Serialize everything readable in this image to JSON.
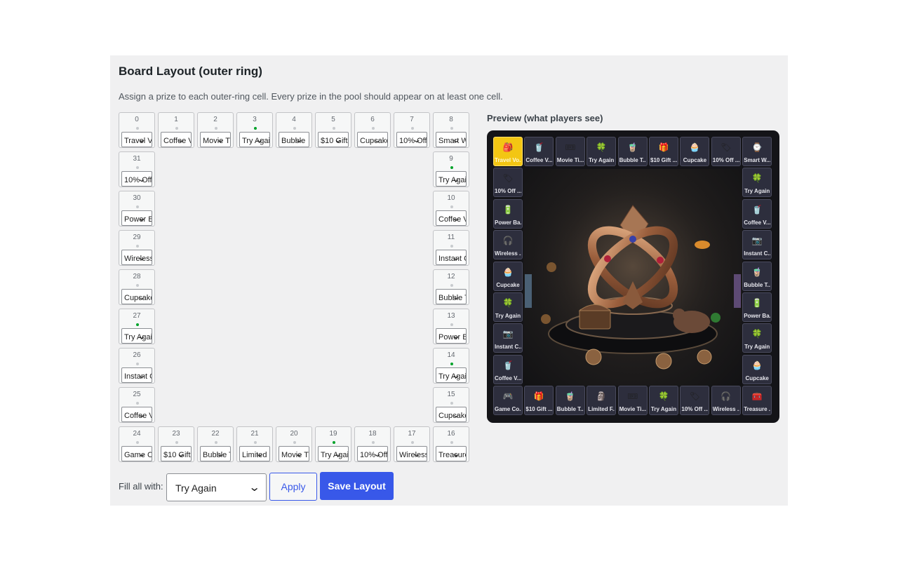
{
  "title": "Board Layout (outer ring)",
  "description": "Assign a prize to each outer-ring cell. Every prize in the pool should appear on at least one cell.",
  "cells": [
    {
      "index": "0",
      "value": "Travel V"
    },
    {
      "index": "1",
      "value": "Coffee V"
    },
    {
      "index": "2",
      "value": "Movie T"
    },
    {
      "index": "3",
      "value": "Try Agai"
    },
    {
      "index": "4",
      "value": "Bubble"
    },
    {
      "index": "5",
      "value": "$10 Gift"
    },
    {
      "index": "6",
      "value": "Cupcake"
    },
    {
      "index": "7",
      "value": "10% Off"
    },
    {
      "index": "8",
      "value": "Smart W"
    },
    {
      "index": "9",
      "value": "Try Agai"
    },
    {
      "index": "10",
      "value": "Coffee V"
    },
    {
      "index": "11",
      "value": "Instant C"
    },
    {
      "index": "12",
      "value": "Bubble T"
    },
    {
      "index": "13",
      "value": "Power B"
    },
    {
      "index": "14",
      "value": "Try Agai"
    },
    {
      "index": "15",
      "value": "Cupcake"
    },
    {
      "index": "16",
      "value": "Treasure"
    },
    {
      "index": "17",
      "value": "Wireless"
    },
    {
      "index": "18",
      "value": "10% Off"
    },
    {
      "index": "19",
      "value": "Try Agai"
    },
    {
      "index": "20",
      "value": "Movie T"
    },
    {
      "index": "21",
      "value": "Limited"
    },
    {
      "index": "22",
      "value": "Bubble T"
    },
    {
      "index": "23",
      "value": "$10 Gift"
    },
    {
      "index": "24",
      "value": "Game C"
    },
    {
      "index": "25",
      "value": "Coffee V"
    },
    {
      "index": "26",
      "value": "Instant C"
    },
    {
      "index": "27",
      "value": "Try Agai"
    },
    {
      "index": "28",
      "value": "Cupcake"
    },
    {
      "index": "29",
      "value": "Wireless"
    },
    {
      "index": "30",
      "value": "Power B"
    },
    {
      "index": "31",
      "value": "10% Off"
    }
  ],
  "preview": {
    "title": "Preview (what players see)",
    "tiles": [
      {
        "label": "Travel Vo...",
        "icon": "🎒",
        "active": true
      },
      {
        "label": "Coffee V...",
        "icon": "🥤"
      },
      {
        "label": "Movie Ti...",
        "icon": "🎟"
      },
      {
        "label": "Try Again",
        "icon": "🍀"
      },
      {
        "label": "Bubble T...",
        "icon": "🧋"
      },
      {
        "label": "$10 Gift ...",
        "icon": "🎁"
      },
      {
        "label": "Cupcake",
        "icon": "🧁"
      },
      {
        "label": "10% Off ...",
        "icon": "🏷"
      },
      {
        "label": "Smart W...",
        "icon": "⌚"
      },
      {
        "label": "Try Again",
        "icon": "🍀"
      },
      {
        "label": "Coffee V...",
        "icon": "🥤"
      },
      {
        "label": "Instant C...",
        "icon": "📷"
      },
      {
        "label": "Bubble T...",
        "icon": "🧋"
      },
      {
        "label": "Power Ba...",
        "icon": "🔋"
      },
      {
        "label": "Try Again",
        "icon": "🍀"
      },
      {
        "label": "Cupcake",
        "icon": "🧁"
      },
      {
        "label": "Treasure ...",
        "icon": "🧰"
      },
      {
        "label": "Wireless ...",
        "icon": "🎧"
      },
      {
        "label": "10% Off ...",
        "icon": "🏷"
      },
      {
        "label": "Try Again",
        "icon": "🍀"
      },
      {
        "label": "Movie Ti...",
        "icon": "🎟"
      },
      {
        "label": "Limited F...",
        "icon": "🗿"
      },
      {
        "label": "Bubble T...",
        "icon": "🧋"
      },
      {
        "label": "$10 Gift ...",
        "icon": "🎁"
      },
      {
        "label": "Game Co...",
        "icon": "🎮"
      },
      {
        "label": "Coffee V...",
        "icon": "🥤"
      },
      {
        "label": "Instant C...",
        "icon": "📷"
      },
      {
        "label": "Try Again",
        "icon": "🍀"
      },
      {
        "label": "Cupcake",
        "icon": "🧁"
      },
      {
        "label": "Wireless ...",
        "icon": "🎧"
      },
      {
        "label": "Power Ba...",
        "icon": "🔋"
      },
      {
        "label": "10% Off ...",
        "icon": "🏷"
      }
    ]
  },
  "fill": {
    "label": "Fill all with:",
    "value": "Try Again"
  },
  "buttons": {
    "apply": "Apply",
    "save": "Save Layout"
  },
  "colors": {
    "accent": "#3858e9",
    "active_tile": "#f3c613",
    "dot_green": "#00a32a"
  }
}
